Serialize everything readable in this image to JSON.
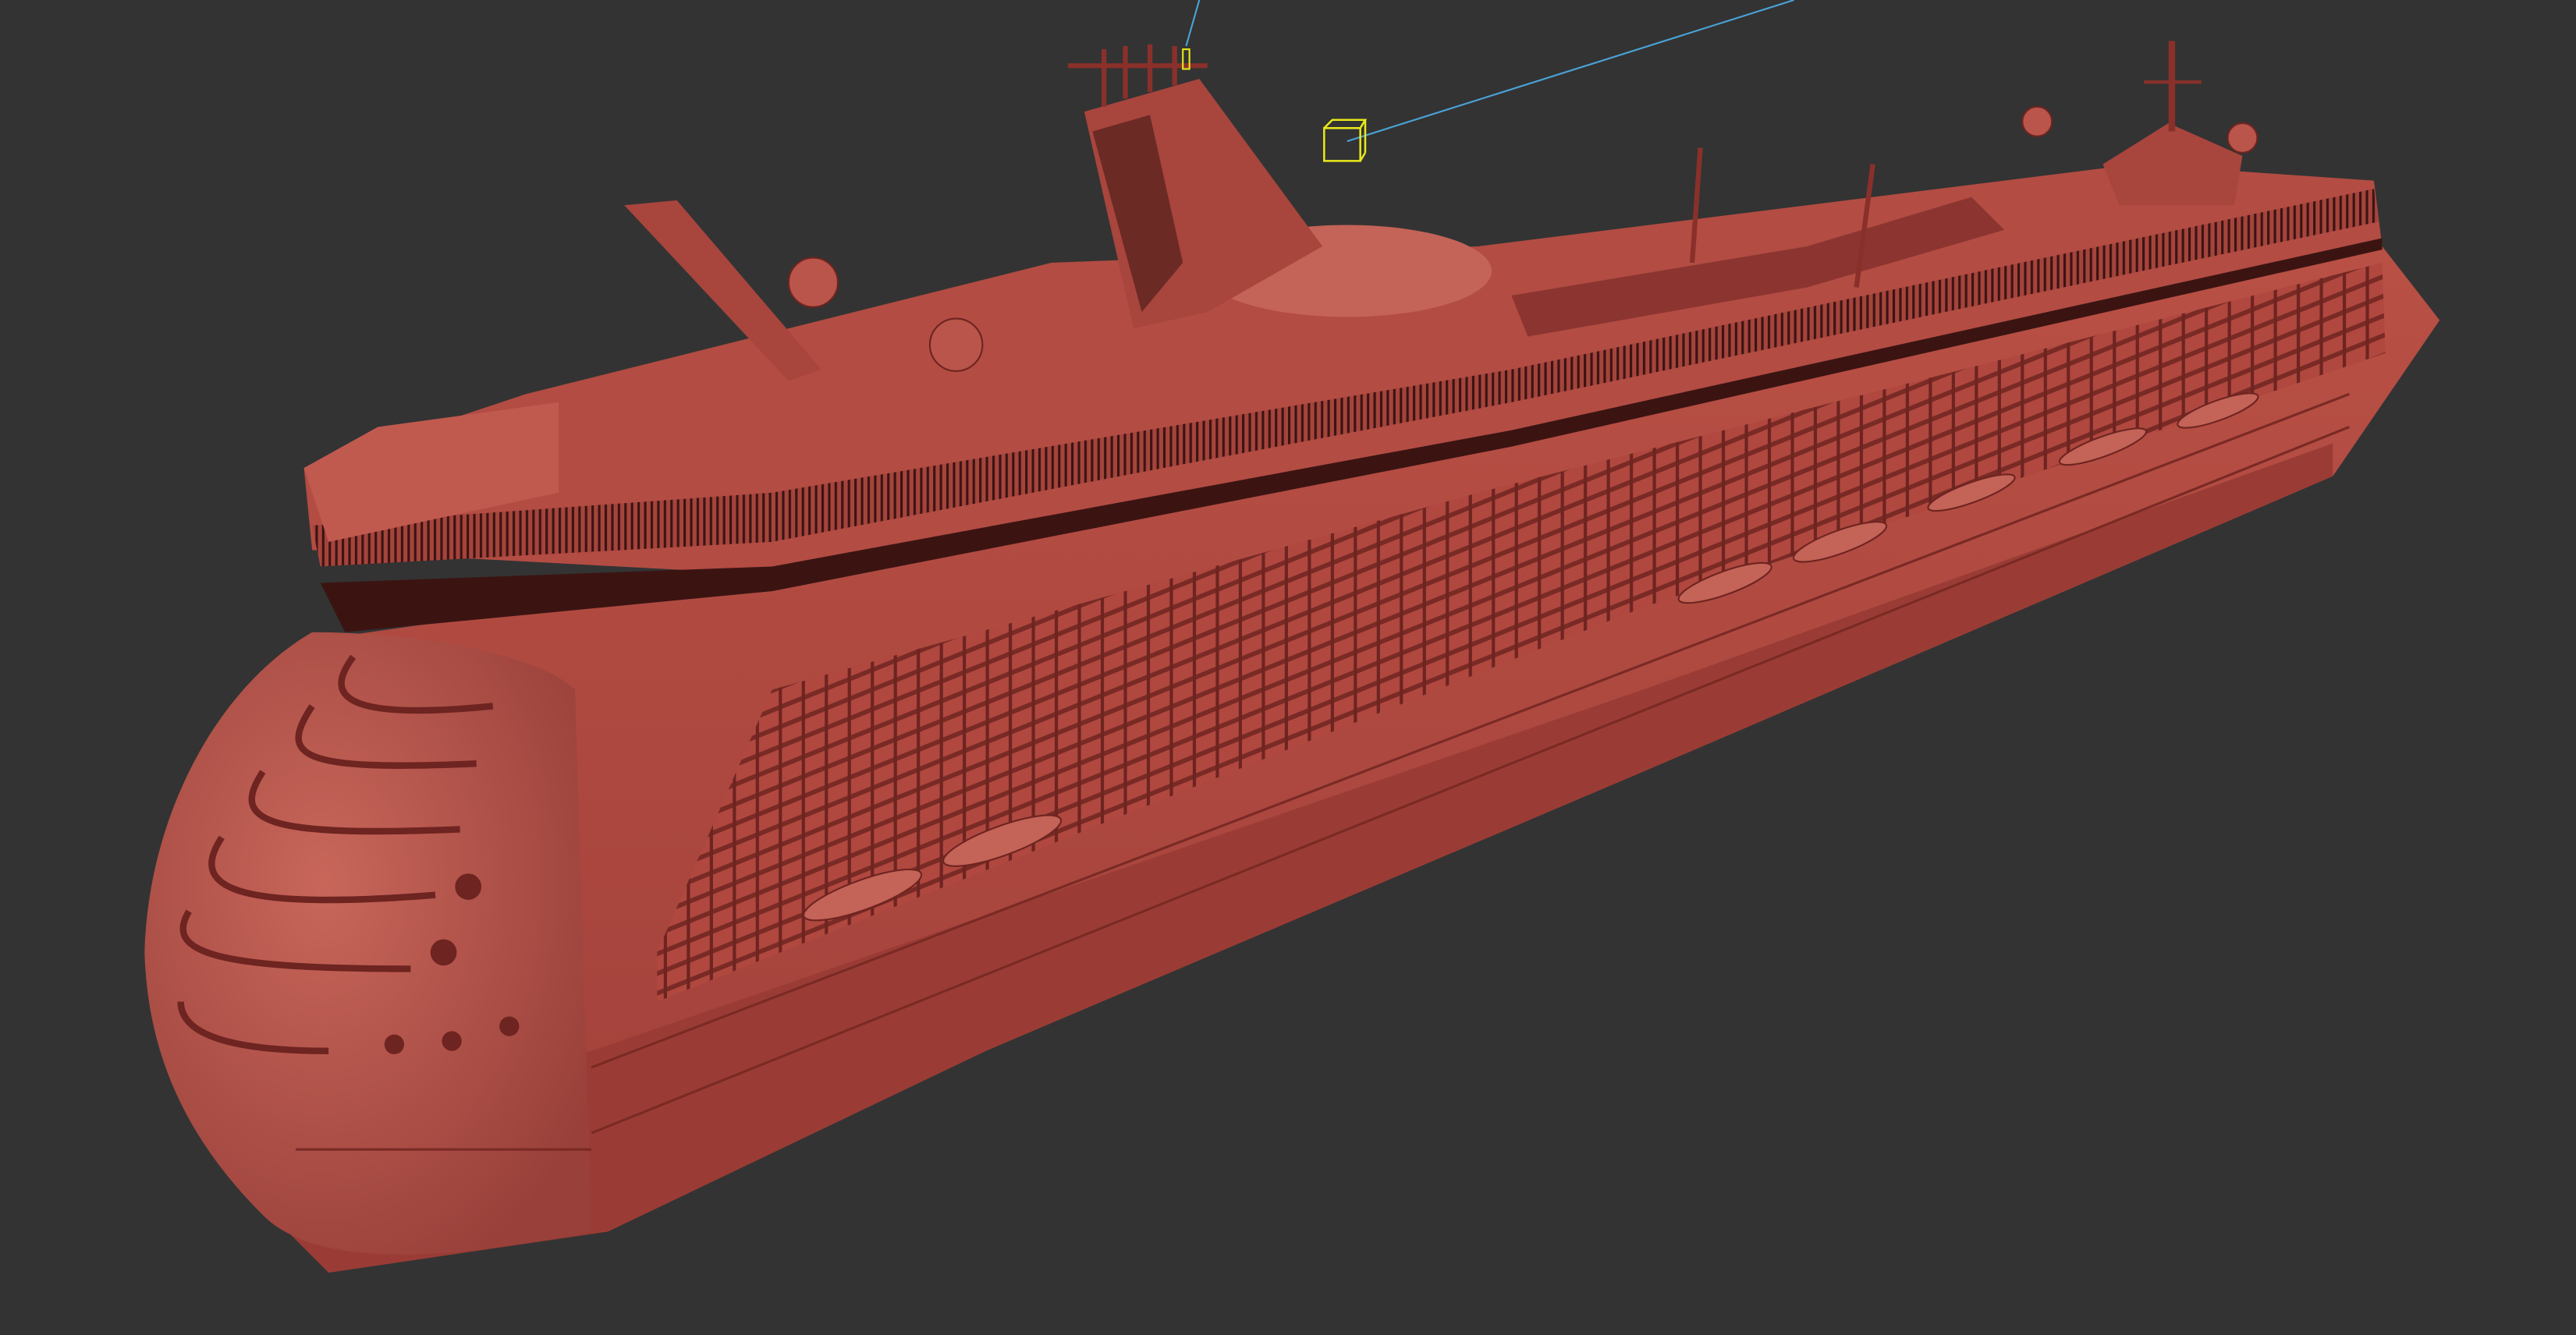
{
  "viewport": {
    "background_color": "#333333",
    "model_color": "#b84e43",
    "model_shadow_color": "#6e2420",
    "model_highlight_color": "#cf6a5c",
    "selection_color": "#e8e81c",
    "guide_line_color": "#4aa3d8"
  },
  "scene": {
    "object": "cruise-ship-model",
    "selected_helper": "yellow-box-helper"
  }
}
